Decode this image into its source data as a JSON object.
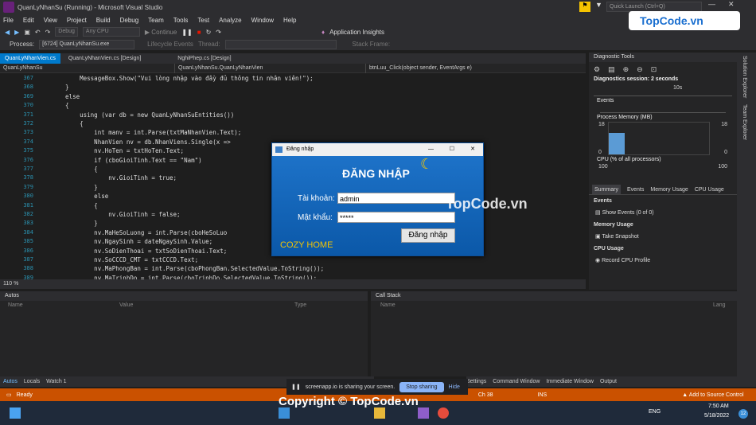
{
  "window": {
    "title": "QuanLyNhanSu (Running) - Microsoft Visual Studio",
    "quick_launch": "Quick Launch (Ctrl+Q)",
    "user_initial": "T"
  },
  "menu": [
    "File",
    "Edit",
    "View",
    "Project",
    "Build",
    "Debug",
    "Team",
    "Tools",
    "Test",
    "Analyze",
    "Window",
    "Help"
  ],
  "toolbar": {
    "config": "Debug",
    "platform": "Any CPU",
    "continue": "Continue",
    "insights": "Application Insights"
  },
  "toolbar2": {
    "process_label": "Process:",
    "process": "[6724] QuanLyNhanSu.exe",
    "lifecycle": "Lifecycle Events",
    "thread": "Thread:",
    "stackframe": "Stack Frame:"
  },
  "tabs": [
    "QuanLyNhanVien.cs",
    "QuanLyNhanVien.cs [Design]",
    "NghiPhep.cs [Design]"
  ],
  "navbar": {
    "project": "QuanLyNhanSu",
    "class": "QuanLyNhanSu.QuanLyNhanVien",
    "method": "btnLuu_Click(object sender, EventArgs e)"
  },
  "code_lines": [
    {
      "n": "367",
      "t": "        MessageBox.Show(\"Vui lòng nhập vào đầy đủ thông tin nhân viên!\");"
    },
    {
      "n": "368",
      "t": "    }"
    },
    {
      "n": "369",
      "t": "    else"
    },
    {
      "n": "370",
      "t": "    {"
    },
    {
      "n": "371",
      "t": "        using (var db = new QuanLyNhanSuEntities())"
    },
    {
      "n": "372",
      "t": "        {"
    },
    {
      "n": "373",
      "t": "            int manv = int.Parse(txtMaNhanVien.Text);"
    },
    {
      "n": "374",
      "t": "            NhanVien nv = db.NhanViens.Single(x => "
    },
    {
      "n": "375",
      "t": "            nv.HoTen = txtHoTen.Text;"
    },
    {
      "n": "376",
      "t": "            if (cboGioiTinh.Text == \"Nam\")"
    },
    {
      "n": "377",
      "t": "            {"
    },
    {
      "n": "378",
      "t": "                nv.GioiTinh = true;"
    },
    {
      "n": "379",
      "t": "            }"
    },
    {
      "n": "380",
      "t": "            else"
    },
    {
      "n": "381",
      "t": "            {"
    },
    {
      "n": "382",
      "t": "                nv.GioiTinh = false;"
    },
    {
      "n": "383",
      "t": "            }"
    },
    {
      "n": "384",
      "t": "            nv.MaHeSoLuong = int.Parse(cboHeSoLuo"
    },
    {
      "n": "385",
      "t": "            nv.NgaySinh = dateNgaySinh.Value;"
    },
    {
      "n": "386",
      "t": "            nv.SoDienThoai = txtSoDienThoai.Text;"
    },
    {
      "n": "387",
      "t": "            nv.SoCCCD_CMT = txtCCCD.Text;"
    },
    {
      "n": "388",
      "t": "            nv.MaPhongBan = int.Parse(cboPhongBan.SelectedValue.ToString());"
    },
    {
      "n": "389",
      "t": "            nv.MaTrinhDo = int.Parse(cboTrinhDo.SelectedValue.ToString());"
    }
  ],
  "zoom": "110 %",
  "autos": {
    "title": "Autos",
    "cols": [
      "Name",
      "Value",
      "Type"
    ]
  },
  "callstack": {
    "title": "Call Stack",
    "cols": [
      "Name",
      "Lang"
    ]
  },
  "bottom_tabs": [
    "Autos",
    "Locals",
    "Watch 1"
  ],
  "bottom_tabs_right": [
    "Settings",
    "Command Window",
    "Immediate Window",
    "Output"
  ],
  "diagnostics": {
    "title": "Diagnostic Tools",
    "session": "Diagnostics session: 2 seconds",
    "tick": "10s",
    "events": "Events",
    "process_memory": "Process Memory (MB)",
    "mem_max": "18",
    "mem_min": "0",
    "mem_fill_fraction": 0.67,
    "cpu": "CPU (% of all processors)",
    "cpu_max": "100",
    "tabs": [
      "Summary",
      "Events",
      "Memory Usage",
      "CPU Usage"
    ],
    "sec_events": "Events",
    "show_events": "Show Events (0 of 0)",
    "sec_memory": "Memory Usage",
    "take_snapshot": "Take Snapshot",
    "sec_cpu": "CPU Usage",
    "record_cpu": "Record CPU Profile"
  },
  "right_strip": [
    "Solution Explorer",
    "Team Explorer"
  ],
  "status": {
    "ready": "Ready",
    "ch": "Ch 38",
    "ins": "INS",
    "source_control": "Add to Source Control"
  },
  "dialog": {
    "title": "Đăng nhập",
    "heading": "ĐĂNG NHẬP",
    "user_label": "Tài khoản:",
    "user_value": "admin",
    "pass_label": "Mật khẩu:",
    "pass_value": "*****",
    "login_button": "Đăng nhập",
    "brand": "COZY HOME"
  },
  "share": {
    "text": "screenapp.io is sharing your screen.",
    "stop": "Stop sharing",
    "hide": "Hide"
  },
  "taskbar": {
    "lang": "ENG",
    "time": "7:50 AM",
    "date": "5/18/2022",
    "notif": "12"
  },
  "watermark": "TopCode.vn",
  "copyright": "Copyright © TopCode.vn"
}
